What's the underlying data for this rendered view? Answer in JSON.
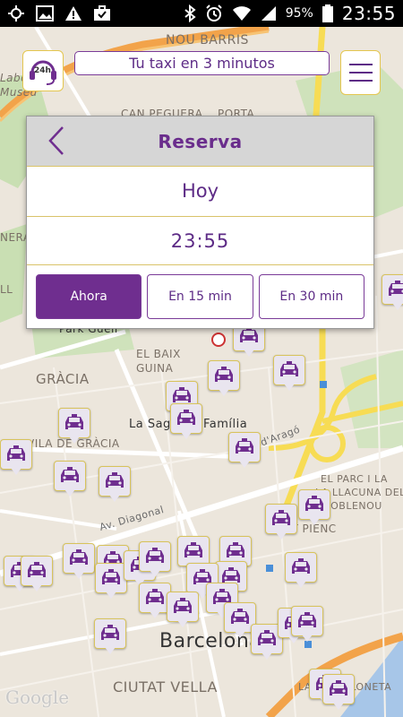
{
  "status_bar": {
    "battery": "95%",
    "time": "23:55",
    "icons": [
      "gps-icon",
      "image-icon",
      "warning-icon",
      "briefcase-icon",
      "bluetooth-icon",
      "alarm-icon",
      "wifi-icon",
      "signal-icon",
      "battery-icon"
    ]
  },
  "top_controls": {
    "support_label": "24h",
    "eta_text": "Tu taxi en 3 minutos"
  },
  "reservation": {
    "title": "Reserva",
    "day": "Hoy",
    "time": "23:55",
    "options": [
      {
        "label": "Ahora",
        "selected": true
      },
      {
        "label": "En 15 min",
        "selected": false
      },
      {
        "label": "En 30 min",
        "selected": false
      }
    ]
  },
  "map": {
    "labels": {
      "nou_barris": "NOU BARRIS",
      "porta": "PORTA",
      "can_peguera": "CAN PEGUERA",
      "labe": "Labe",
      "museu": "Museu",
      "nera": "NERA",
      "ll": "LL",
      "park_guell": "Park Güell",
      "gracia": "GRÀCIA",
      "el_baix": "EL BAIX",
      "guina": "GUINA",
      "sagrada": "La Sagrada Família",
      "vila_gracia": "VILA DE GRÀCIA",
      "arago": "d'Aragó",
      "diagonal": "Av. Diagonal",
      "parc_1": "EL PARC I LA",
      "parc_2": "LA LLACUNA DEL",
      "parc_3": "POBLENOU",
      "fort_pienc": "FORT PIENC",
      "barcelona": "Barcelona",
      "ciutat_vella": "CIUTAT VELLA",
      "barceloneta": "LA BARCELONETA",
      "google": "Google"
    }
  },
  "colors": {
    "brand_purple": "#6f2e8f",
    "accent_gold": "#e4c64f"
  }
}
